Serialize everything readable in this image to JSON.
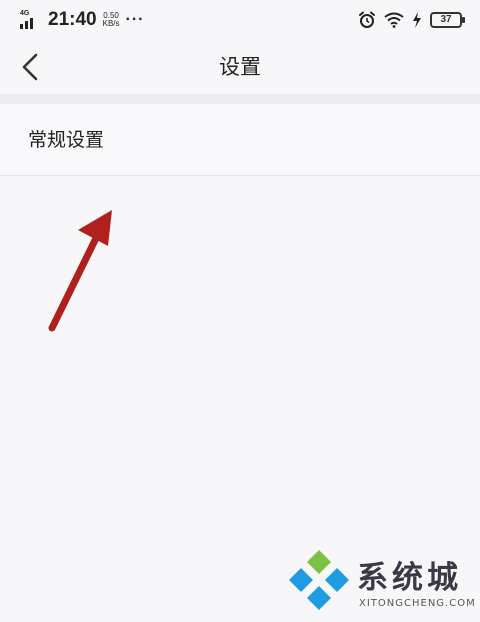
{
  "status_bar": {
    "network_label": "4G",
    "time": "21:40",
    "net_speed_value": "0.50",
    "net_speed_unit": "KB/s",
    "more_dots": "···",
    "battery_level": "37",
    "icons": [
      "signal-icon",
      "alarm-icon",
      "wifi-icon",
      "charging-icon",
      "battery-icon"
    ]
  },
  "header": {
    "title": "设置",
    "back_icon": "chevron-left-icon"
  },
  "settings_list": [
    {
      "label": "常规设置"
    }
  ],
  "watermark": {
    "title": "系统城",
    "subtitle": "XITONGCHENG.COM"
  },
  "colors": {
    "background": "#f7f7f9",
    "section_gap": "#ececf0",
    "arrow": "#b0211d",
    "logo_blue": "#1e9be3",
    "logo_green": "#7cc242"
  }
}
